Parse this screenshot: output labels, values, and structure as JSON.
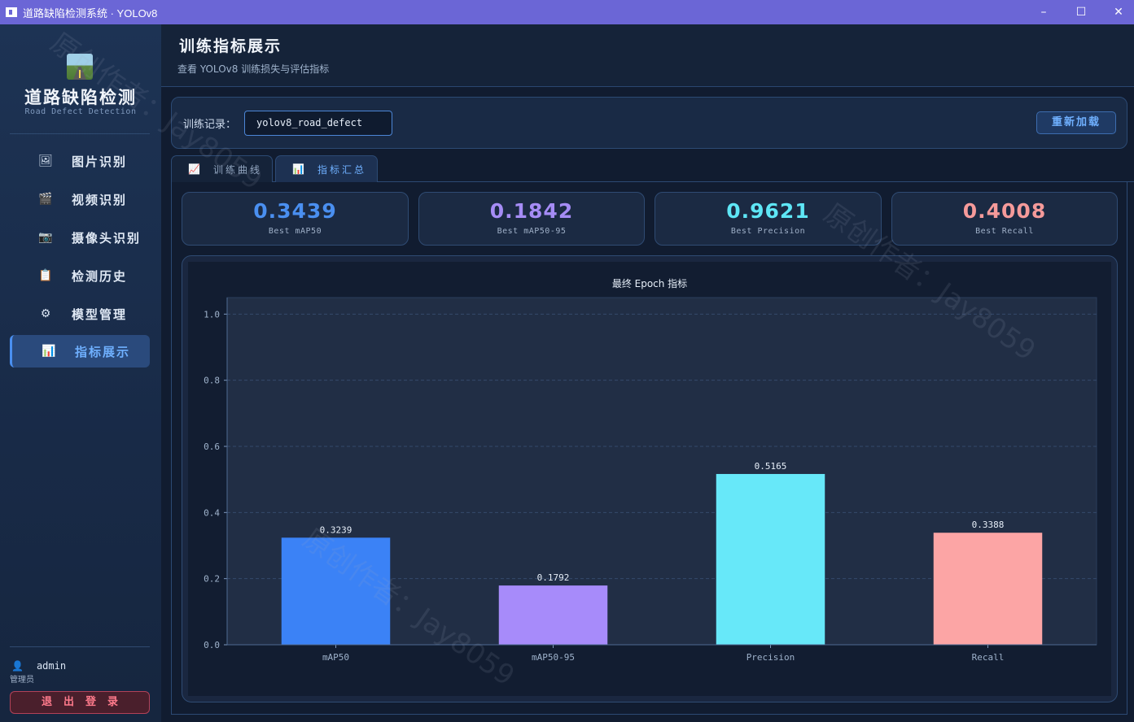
{
  "window": {
    "title": "道路缺陷检测系统 · YOLOv8",
    "minimize": "–",
    "maximize": "☐",
    "close": "✕"
  },
  "sidebar": {
    "brand_title": "道路缺陷检测",
    "brand_subtitle": "Road Defect Detection",
    "items": [
      {
        "icon": "🖼",
        "label": "图片识别"
      },
      {
        "icon": "🎬",
        "label": "视频识别"
      },
      {
        "icon": "📷",
        "label": "摄像头识别"
      },
      {
        "icon": "📋",
        "label": "检测历史"
      },
      {
        "icon": "⚙",
        "label": "模型管理"
      },
      {
        "icon": "📊",
        "label": "指标展示"
      }
    ],
    "user_icon": "👤",
    "username": "admin",
    "role": "管理员",
    "logout_label": "退出登录"
  },
  "header": {
    "title": "训练指标展示",
    "subtitle": "查看 YOLOv8 训练损失与评估指标"
  },
  "record": {
    "label": "训练记录：",
    "value": "yolov8_road_defect",
    "reload_label": "重新加载"
  },
  "tabs": [
    {
      "icon": "📈",
      "label": "训练曲线"
    },
    {
      "icon": "📊",
      "label": "指标汇总"
    }
  ],
  "metrics": [
    {
      "value": "0.3439",
      "label": "Best mAP50",
      "color": "#4a8ff0"
    },
    {
      "value": "0.1842",
      "label": "Best mAP50-95",
      "color": "#a58cf5"
    },
    {
      "value": "0.9621",
      "label": "Best Precision",
      "color": "#5ee6f6"
    },
    {
      "value": "0.4008",
      "label": "Best Recall",
      "color": "#f59a9a"
    }
  ],
  "watermark": "原创作者：Jay8059",
  "chart_data": {
    "type": "bar",
    "title": "最终 Epoch 指标",
    "categories": [
      "mAP50",
      "mAP50-95",
      "Precision",
      "Recall"
    ],
    "values": [
      0.3239,
      0.1792,
      0.5165,
      0.3388
    ],
    "value_labels": [
      "0.3239",
      "0.1792",
      "0.5165",
      "0.3388"
    ],
    "colors": [
      "#3b82f6",
      "#a78bfa",
      "#67e8f9",
      "#fca5a5"
    ],
    "ylim": [
      0,
      1.05
    ],
    "yticks": [
      0.0,
      0.2,
      0.4,
      0.6,
      0.8,
      1.0
    ],
    "ytick_labels": [
      "0.0",
      "0.2",
      "0.4",
      "0.6",
      "0.8",
      "1.0"
    ],
    "grid": true,
    "xlabel": "",
    "ylabel": ""
  }
}
